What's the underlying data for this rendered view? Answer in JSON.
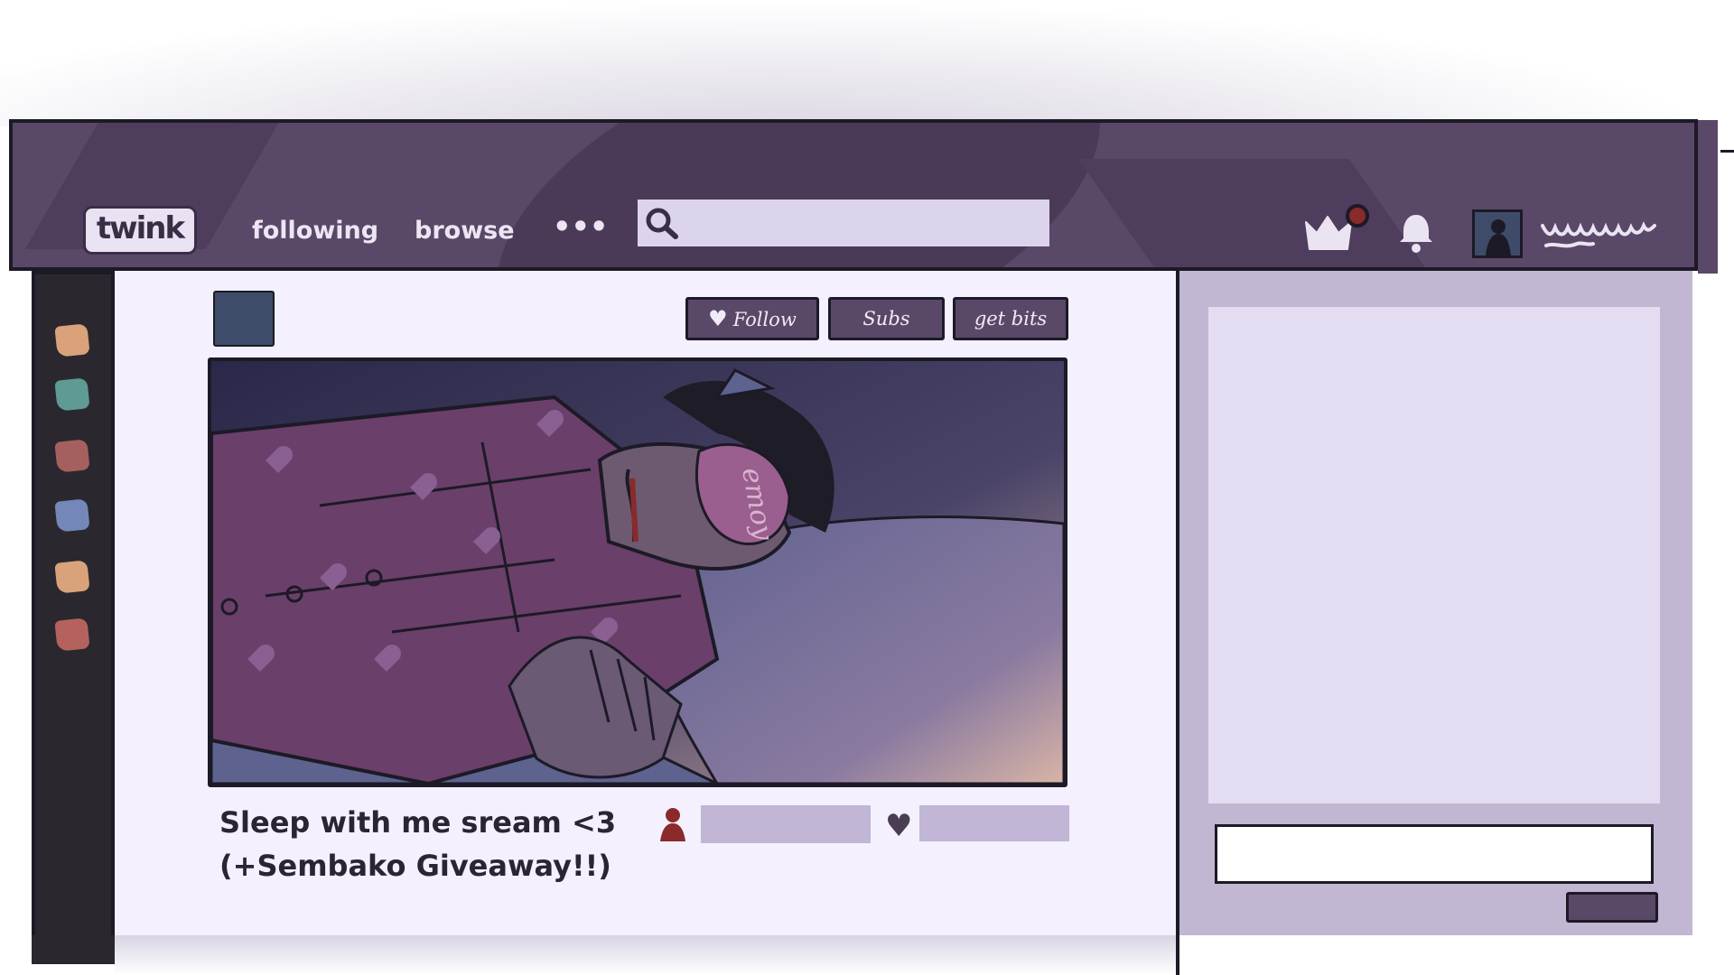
{
  "nav": {
    "logo": "twink",
    "links": [
      "following",
      "browse"
    ],
    "more": "•••",
    "search_placeholder": "",
    "icons": [
      "search-icon",
      "crown-icon",
      "notification-dot",
      "bell-icon",
      "user-avatar",
      "username-scribble"
    ]
  },
  "sidebar": {
    "channel_colors": [
      "#d9a27a",
      "#5f9a94",
      "#a65f5f",
      "#7388b8",
      "#d9a27a",
      "#b5625e"
    ]
  },
  "stream": {
    "buttons": {
      "follow": "Follow",
      "subs": "Subs",
      "bits": "get bits"
    },
    "title_line1": "Sleep with me sream <3",
    "title_line2": "(+Sembako Giveaway!!)",
    "mask_text": "emoy"
  },
  "colors": {
    "nav_bg": "#5a4868",
    "accent": "#5a4868",
    "main_bg": "#f4f0fd",
    "chat_bg": "#c1b7d3",
    "notification": "#8a2a2a"
  }
}
